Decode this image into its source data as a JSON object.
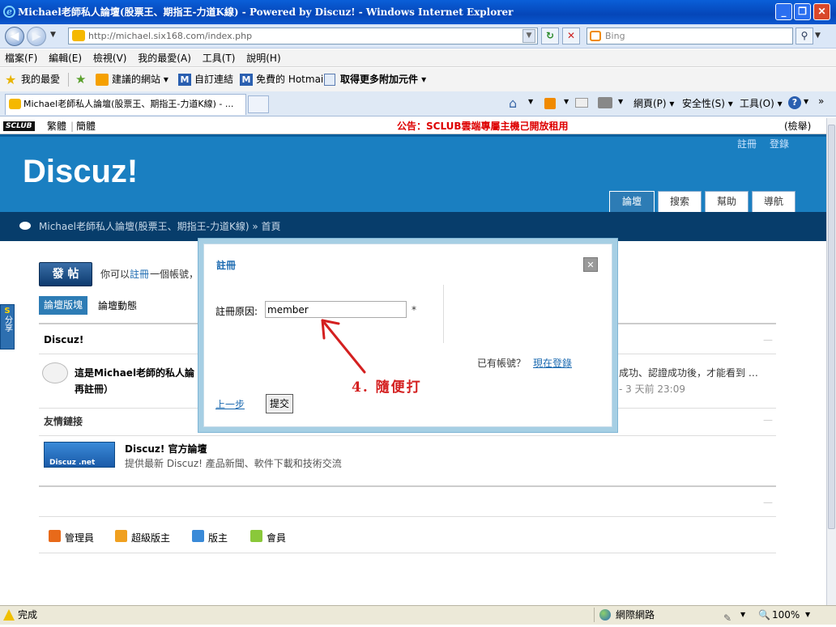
{
  "window": {
    "title": "Michael老師私人論壇(股票王、期指王-力道K線) - Powered by Discuz! - Windows Internet Explorer"
  },
  "address": {
    "url": "http://michael.six168.com/index.php",
    "search_placeholder": "Bing"
  },
  "menu": [
    "檔案(F)",
    "編輯(E)",
    "檢視(V)",
    "我的最愛(A)",
    "工具(T)",
    "說明(H)"
  ],
  "favorites": {
    "label": "我的最愛",
    "items": [
      "建議的網站 ▾",
      "自訂連結",
      "免費的 Hotmail",
      "取得更多附加元件 ▾"
    ]
  },
  "tab": {
    "title": "Michael老師私人論壇(股票王、期指王-力道K線) - ..."
  },
  "commandbar": {
    "page": "網頁(P) ▾",
    "safety": "安全性(S) ▾",
    "tools": "工具(O) ▾"
  },
  "site": {
    "brand": "SCLUB",
    "lang_trad": "繁體",
    "lang_simp": "簡體",
    "announcement": "公告：SCLUB雲端專屬主機己開放租用",
    "report": "(檢舉)",
    "register": "註冊",
    "login": "登錄",
    "logo": "Discuz!",
    "nav": [
      "論壇",
      "搜索",
      "幫助",
      "導航"
    ],
    "breadcrumb": "Michael老師私人論壇(股票王、期指王-力道K線) » 首頁",
    "share": "分享"
  },
  "main": {
    "post_button": "發 帖",
    "info_prefix": "你可以",
    "info_link": "註冊",
    "info_suffix": "一個帳號，",
    "tab_forum": "論壇版塊",
    "tab_activity": "論壇動態",
    "section_title": "Discuz!",
    "forum_title": "這是Michael老師的私人論",
    "forum_title2": "再註冊）",
    "forum_right": "成功、認證成功後，才能看到 …",
    "forum_time": "- 3 天前 23:09",
    "friends_title": "友情鏈接",
    "friend_badge": "Discuz .net",
    "friend_name": "Discuz! 官方論壇",
    "friend_desc": "提供最新 Discuz! 產品新聞、軟件下載和技術交流",
    "legend": [
      "管理員",
      "超級版主",
      "版主",
      "會員"
    ]
  },
  "modal": {
    "title": "註冊",
    "reason_label": "註冊原因:",
    "reason_value": "member",
    "required_mark": "*",
    "have_account": "已有帳號？",
    "login_now": "現在登錄",
    "prev_step": "上一步",
    "submit": "提交",
    "close": "✕"
  },
  "annotation": {
    "text": "4. 隨便打"
  },
  "statusbar": {
    "status": "完成",
    "zone": "網際網路",
    "zoom": "100%"
  }
}
